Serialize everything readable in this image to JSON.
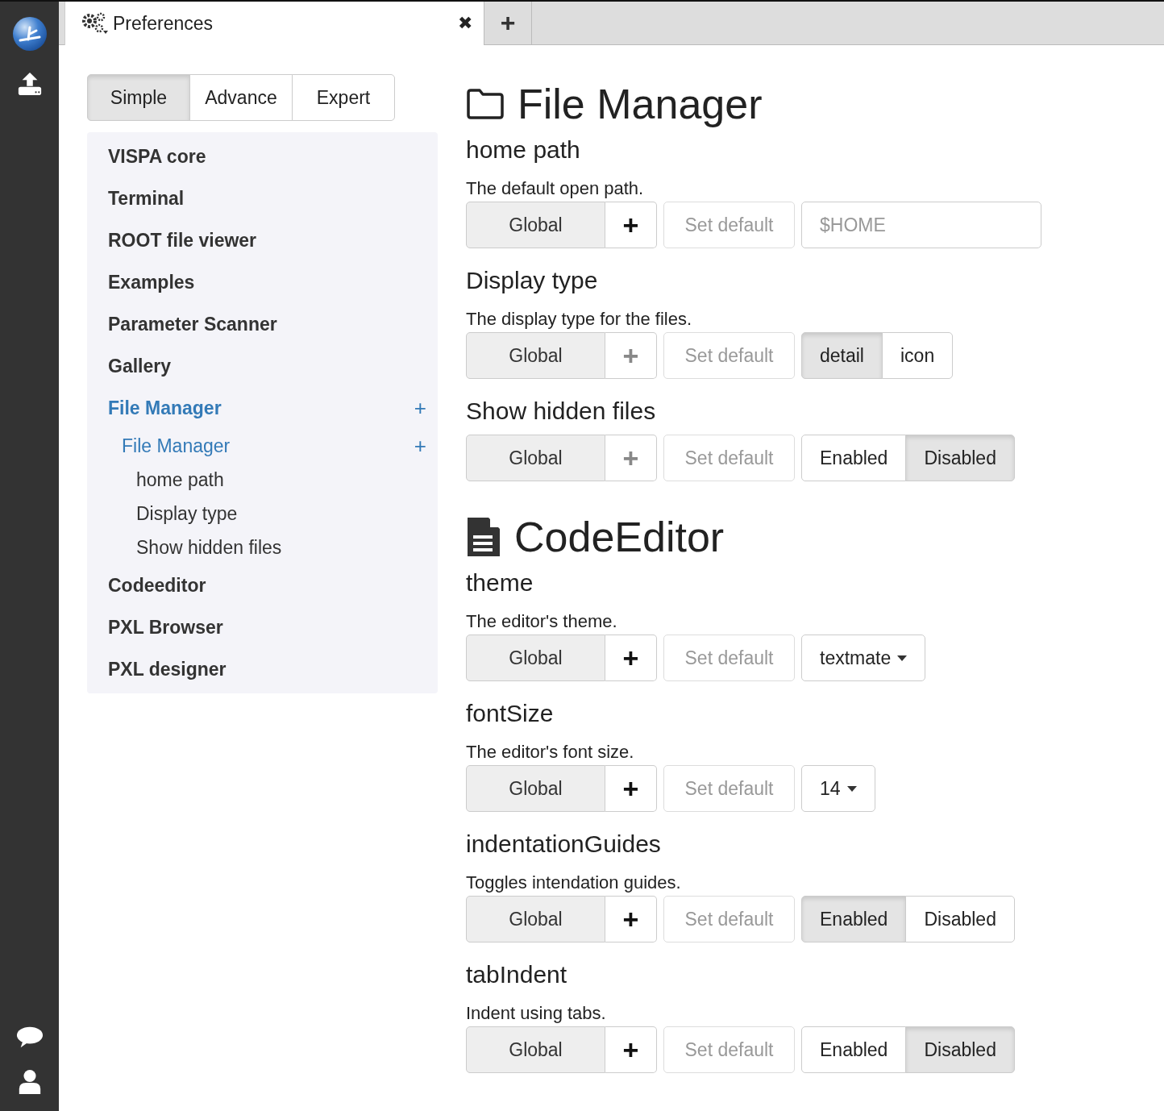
{
  "tab": {
    "title": "Preferences",
    "close": "✖",
    "add": "+"
  },
  "modes": [
    {
      "label": "Simple",
      "selected": true
    },
    {
      "label": "Advance",
      "selected": false
    },
    {
      "label": "Expert",
      "selected": false
    }
  ],
  "nav": [
    {
      "label": "VISPA core",
      "selected": false
    },
    {
      "label": "Terminal",
      "selected": false
    },
    {
      "label": "ROOT file viewer",
      "selected": false
    },
    {
      "label": "Examples",
      "selected": false
    },
    {
      "label": "Parameter Scanner",
      "selected": false
    },
    {
      "label": "Gallery",
      "selected": false
    },
    {
      "label": "File Manager",
      "selected": true,
      "add": "+",
      "children": [
        {
          "label": "File Manager",
          "selected": true,
          "add": "+",
          "children": [
            {
              "label": "home path",
              "selected": false
            },
            {
              "label": "Display type",
              "selected": false
            },
            {
              "label": "Show hidden files",
              "selected": false
            }
          ]
        }
      ]
    },
    {
      "label": "Codeeditor",
      "selected": false
    },
    {
      "label": "PXL Browser",
      "selected": false
    },
    {
      "label": "PXL designer",
      "selected": false
    }
  ],
  "sections": [
    {
      "title": "File Manager",
      "settings": [
        {
          "name": "home path",
          "description": "The default open path.",
          "scope": "Global",
          "add": "+",
          "add_disabled": false,
          "reset": "Set default",
          "control": {
            "kind": "text",
            "placeholder": "$HOME"
          }
        },
        {
          "name": "Display type",
          "description": "The display type for the files.",
          "scope": "Global",
          "add": "+",
          "add_disabled": true,
          "reset": "Set default",
          "control": {
            "kind": "options",
            "options": [
              {
                "label": "detail",
                "selected": true
              },
              {
                "label": "icon",
                "selected": false
              }
            ]
          }
        },
        {
          "name": "Show hidden files",
          "scope": "Global",
          "add": "+",
          "add_disabled": true,
          "reset": "Set default",
          "control": {
            "kind": "options",
            "options": [
              {
                "label": "Enabled",
                "selected": false
              },
              {
                "label": "Disabled",
                "selected": true
              }
            ]
          }
        }
      ]
    },
    {
      "title": "CodeEditor",
      "settings": [
        {
          "name": "theme",
          "description": "The editor's theme.",
          "scope": "Global",
          "add": "+",
          "add_disabled": false,
          "reset": "Set default",
          "control": {
            "kind": "dropdown",
            "value": "textmate"
          }
        },
        {
          "name": "fontSize",
          "description": "The editor's font size.",
          "scope": "Global",
          "add": "+",
          "add_disabled": false,
          "reset": "Set default",
          "control": {
            "kind": "dropdown",
            "value": "14"
          }
        },
        {
          "name": "indentationGuides",
          "description": "Toggles intendation guides.",
          "scope": "Global",
          "add": "+",
          "add_disabled": false,
          "reset": "Set default",
          "control": {
            "kind": "options",
            "options": [
              {
                "label": "Enabled",
                "selected": true
              },
              {
                "label": "Disabled",
                "selected": false
              }
            ]
          }
        },
        {
          "name": "tabIndent",
          "description": "Indent using tabs.",
          "scope": "Global",
          "add": "+",
          "add_disabled": false,
          "reset": "Set default",
          "control": {
            "kind": "options",
            "options": [
              {
                "label": "Enabled",
                "selected": false
              },
              {
                "label": "Disabled",
                "selected": true
              }
            ]
          }
        }
      ]
    }
  ]
}
